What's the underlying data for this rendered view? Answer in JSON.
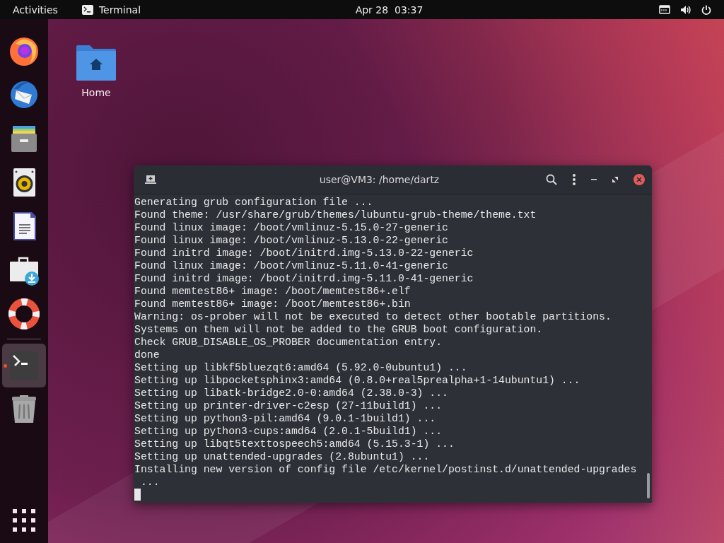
{
  "top_bar": {
    "activities": "Activities",
    "app_name": "Terminal",
    "clock": "Apr 28  03:37"
  },
  "dock": {
    "items": [
      {
        "kind": "browser",
        "running": false
      },
      {
        "kind": "mail",
        "running": false
      },
      {
        "kind": "files",
        "running": false
      },
      {
        "kind": "music",
        "running": false
      },
      {
        "kind": "document",
        "running": false
      },
      {
        "kind": "software",
        "running": false
      },
      {
        "kind": "help",
        "running": false
      },
      {
        "kind": "separator"
      },
      {
        "kind": "terminal",
        "running": true
      },
      {
        "kind": "trash",
        "running": false
      }
    ]
  },
  "desktop_icons": [
    {
      "label": "Home"
    }
  ],
  "terminal": {
    "title": "user@VM3: /home/dartz",
    "lines": [
      "Generating grub configuration file ...",
      "Found theme: /usr/share/grub/themes/lubuntu-grub-theme/theme.txt",
      "Found linux image: /boot/vmlinuz-5.15.0-27-generic",
      "Found linux image: /boot/vmlinuz-5.13.0-22-generic",
      "Found initrd image: /boot/initrd.img-5.13.0-22-generic",
      "Found linux image: /boot/vmlinuz-5.11.0-41-generic",
      "Found initrd image: /boot/initrd.img-5.11.0-41-generic",
      "Found memtest86+ image: /boot/memtest86+.elf",
      "Found memtest86+ image: /boot/memtest86+.bin",
      "Warning: os-prober will not be executed to detect other bootable partitions.",
      "Systems on them will not be added to the GRUB boot configuration.",
      "Check GRUB_DISABLE_OS_PROBER documentation entry.",
      "done",
      "Setting up libkf5bluezqt6:amd64 (5.92.0-0ubuntu1) ...",
      "Setting up libpocketsphinx3:amd64 (0.8.0+real5prealpha+1-14ubuntu1) ...",
      "Setting up libatk-bridge2.0-0:amd64 (2.38.0-3) ...",
      "Setting up printer-driver-c2esp (27-11build1) ...",
      "Setting up python3-pil:amd64 (9.0.1-1build1) ...",
      "Setting up python3-cups:amd64 (2.0.1-5build1) ...",
      "Setting up libqt5texttospeech5:amd64 (5.15.3-1) ...",
      "Setting up unattended-upgrades (2.8ubuntu1) ...",
      "Installing new version of config file /etc/kernel/postinst.d/unattended-upgrades",
      " ..."
    ]
  }
}
